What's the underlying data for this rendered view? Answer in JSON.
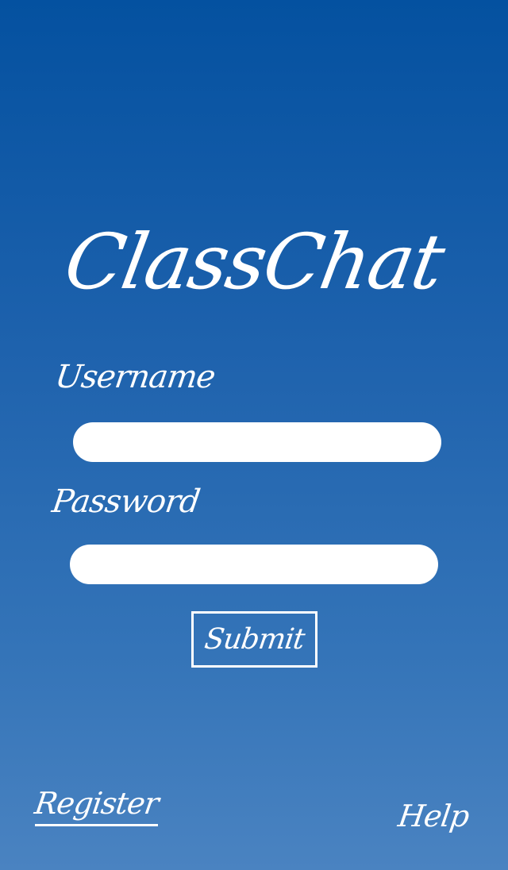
{
  "app": {
    "title": "ClassChat"
  },
  "form": {
    "username_label": "Username",
    "username_value": "",
    "username_placeholder": "",
    "password_label": "Password",
    "password_value": "",
    "password_placeholder": "",
    "submit_label": "Submit"
  },
  "footer": {
    "register_label": "Register",
    "help_label": "Help"
  },
  "colors": {
    "background_top": "#0451a0",
    "background_bottom": "#4a83c1",
    "text": "#ffffff",
    "input_fill": "#ffffff"
  }
}
